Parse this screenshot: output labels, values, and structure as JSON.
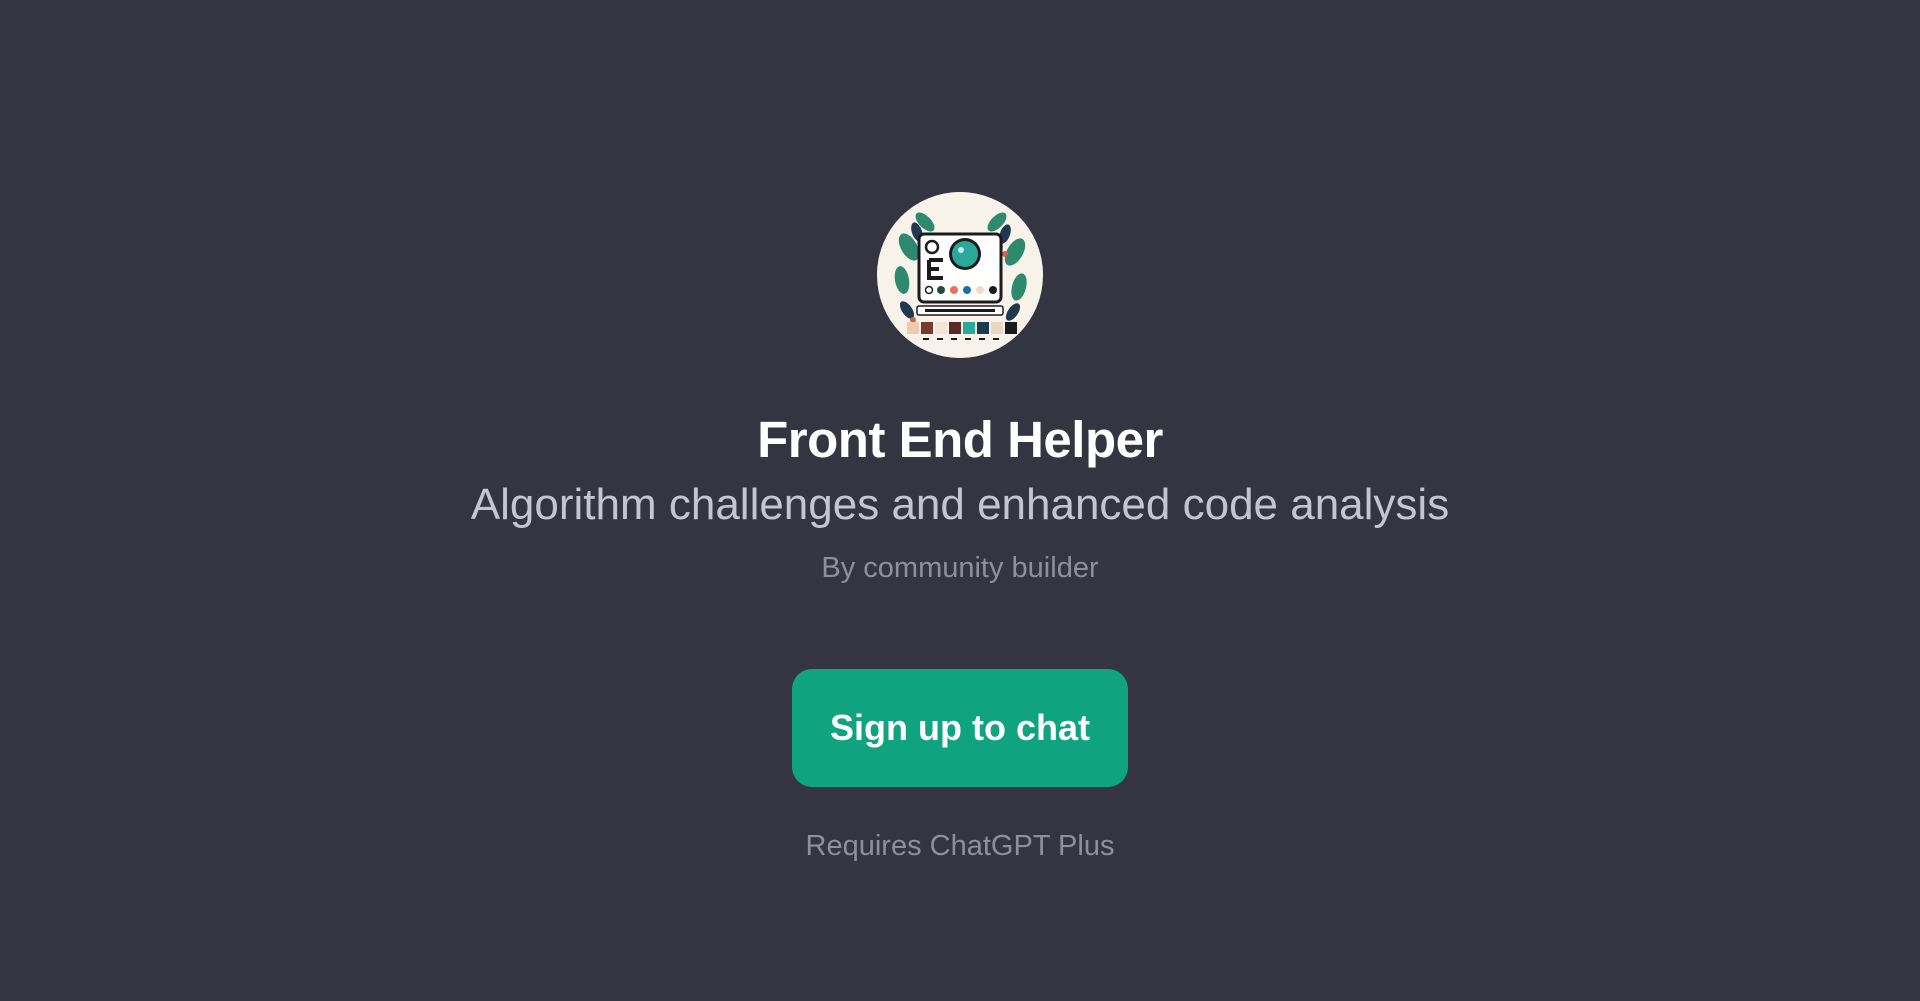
{
  "gpt": {
    "avatar_icon": "front-end-helper-logo",
    "title": "Front End Helper",
    "description": "Algorithm challenges and enhanced code analysis",
    "author": "By community builder"
  },
  "cta": {
    "label": "Sign up to chat",
    "color": "#10a37f"
  },
  "footer": {
    "requirement": "Requires ChatGPT Plus"
  },
  "colors": {
    "background": "#343541",
    "title": "#ffffff",
    "subtitle": "#c5c5d2",
    "muted": "#8e8ea0"
  }
}
